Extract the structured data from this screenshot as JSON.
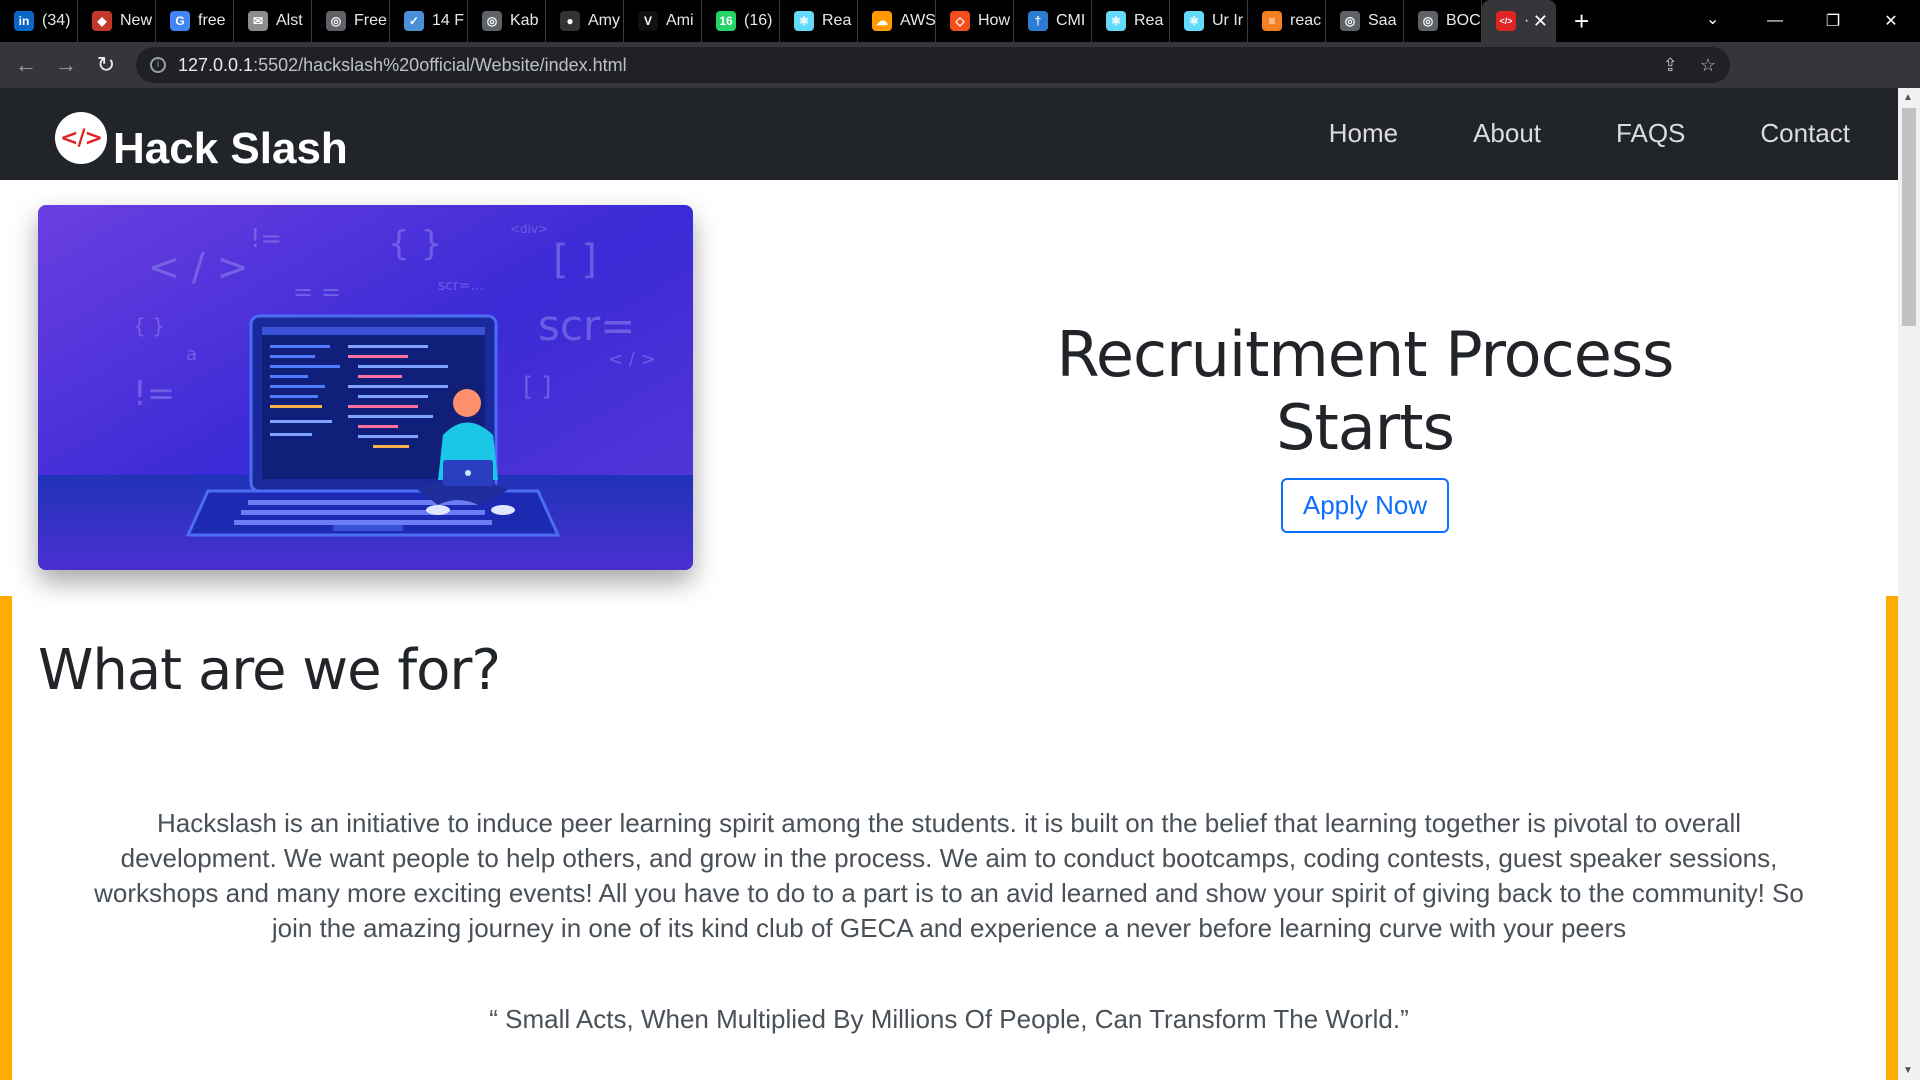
{
  "browser": {
    "tabs": [
      {
        "label": "(34)",
        "icon": "linkedin-icon",
        "color": "#0a66c2",
        "glyph": "in"
      },
      {
        "label": "New",
        "icon": "fox-icon",
        "color": "#c0392b",
        "glyph": "◆"
      },
      {
        "label": "free",
        "icon": "google-icon",
        "color": "#4285f4",
        "glyph": "G"
      },
      {
        "label": "Alst",
        "icon": "mail-icon",
        "color": "#8d8d8d",
        "glyph": "✉"
      },
      {
        "label": "Free",
        "icon": "globe-icon",
        "color": "#5f6368",
        "glyph": "◎"
      },
      {
        "label": "14 F",
        "icon": "checkbox-icon",
        "color": "#4a90d9",
        "glyph": "✓"
      },
      {
        "label": "Kab",
        "icon": "globe-icon",
        "color": "#5f6368",
        "glyph": "◎"
      },
      {
        "label": "Amy",
        "icon": "github-icon",
        "color": "#333333",
        "glyph": "●"
      },
      {
        "label": "Ami",
        "icon": "vercel-icon",
        "color": "#111111",
        "glyph": "V"
      },
      {
        "label": "(16)",
        "icon": "whatsapp-icon",
        "color": "#25d366",
        "glyph": "16"
      },
      {
        "label": "Rea",
        "icon": "react-icon",
        "color": "#61dafb",
        "glyph": "⚛"
      },
      {
        "label": "AWS",
        "icon": "aws-icon",
        "color": "#ff9900",
        "glyph": "☁"
      },
      {
        "label": "How",
        "icon": "code-icon",
        "color": "#f24e1e",
        "glyph": "◇"
      },
      {
        "label": "CMI",
        "icon": "pin-icon",
        "color": "#2b7cd3",
        "glyph": "†"
      },
      {
        "label": "Rea",
        "icon": "react-icon",
        "color": "#61dafb",
        "glyph": "⚛"
      },
      {
        "label": "Ur Ir",
        "icon": "react-icon",
        "color": "#61dafb",
        "glyph": "⚛"
      },
      {
        "label": "reac",
        "icon": "stackoverflow-icon",
        "color": "#f48024",
        "glyph": "≡"
      },
      {
        "label": "Saa",
        "icon": "globe-icon",
        "color": "#5f6368",
        "glyph": "◎"
      },
      {
        "label": "BOC",
        "icon": "globe-icon",
        "color": "#5f6368",
        "glyph": "◎"
      }
    ],
    "active_tab": {
      "label": "·",
      "icon": "hackslash-favicon-icon",
      "color": "#e02424",
      "glyph": "</>"
    },
    "url_host": "127.0.0.1",
    "url_rest": ":5502/hackslash%20official/Website/index.html"
  },
  "site": {
    "brand": "Hack Slash",
    "logo_glyph": "</>",
    "nav": [
      "Home",
      "About",
      "FAQS",
      "Contact"
    ],
    "hero": {
      "title": "Recruitment Process Starts",
      "button": "Apply Now"
    },
    "about": {
      "title": "What are we for?",
      "text": "Hackslash is an initiative to induce peer learning spirit among the students. it is built on the belief that learning together is pivotal to overall development. We want people to help others, and grow in the process. We aim to conduct bootcamps, coding contests, guest speaker sessions, workshops and many more exciting events! All you have to do to a part is to an avid learned and show your spirit of giving back to the community! So join the amazing journey in one of its kind club of GECA and experience a never before learning curve with your peers",
      "quote": "“ Small Acts, When Multiplied By Millions Of People, Can Transform The World.”"
    },
    "colors": {
      "navbar": "#212529",
      "accent_border": "#ffab00",
      "button": "#0d6efd",
      "hero_bg": "#4b2fd0"
    },
    "illustration_code_glyphs": [
      "< / >",
      "!=",
      "{ }",
      "<div>",
      "[ ]",
      "scr=...",
      "= =",
      "{ }",
      "a",
      "scr=",
      "< / >",
      "!=",
      "[ ]"
    ]
  }
}
